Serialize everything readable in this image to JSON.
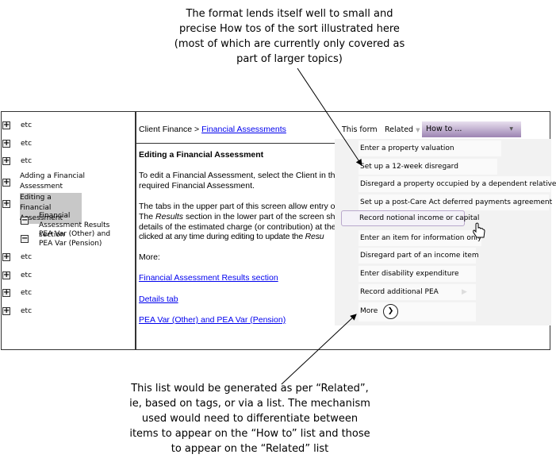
{
  "top_note": "The format lends itself well to small and precise How tos of the sort illustrated here (most of which are currently only covered as part of larger topics)",
  "bottom_note": "This list would be generated as per “Related”, ie, based on tags, or via a list. The mechanism used would need to differentiate between items to appear on the “How to” list and those to appear on the “Related” list",
  "tree": {
    "items": [
      "etc",
      "etc",
      "etc",
      "Adding a Financial Assessment",
      "Editing a Financial Assessment",
      "Financial Assessment Results section",
      "PEA Var (Other) and PEA Var (Pension)",
      "etc",
      "etc",
      "etc",
      "etc"
    ]
  },
  "breadcrumb": {
    "root": "Client Finance >",
    "link": "Financial Assessments"
  },
  "content": {
    "title": "Editing a Financial Assessment",
    "p1a": "To edit a Financial Assessment, select the Client in the",
    "p1b": "required Financial Assessment.",
    "p2a": "The tabs in the upper part of this screen allow entry of",
    "p2b_pre": "The ",
    "p2b_em": "Results",
    "p2b_post": " section in the lower part of the screen sh",
    "p2c": "details of the estimated charge (or contribution) at the",
    "p2d_pre": "clicked at any time during editing to update the ",
    "p2d_em": "Resu",
    "more": "More:",
    "links": [
      "Financial Assessment Results section",
      "Details tab",
      "PEA Var (Other) and PEA Var (Pension)"
    ]
  },
  "toolbar": {
    "this_form": "This form",
    "related": "Related",
    "howto": "How to ...",
    "accent": "#9c84b2"
  },
  "menu": {
    "items": [
      "Enter a property valuation",
      "Set up a 12-week disregard",
      "Disregard a property occupied by a dependent relative",
      "Set up a post-Care Act deferred payments agreement",
      "Record notional income or capital",
      "Enter an item for information only",
      "Disregard part of an income item",
      "Enter disability expenditure",
      "Record additional PEA"
    ],
    "more": "More",
    "hovered": "Record notional income or capital"
  }
}
